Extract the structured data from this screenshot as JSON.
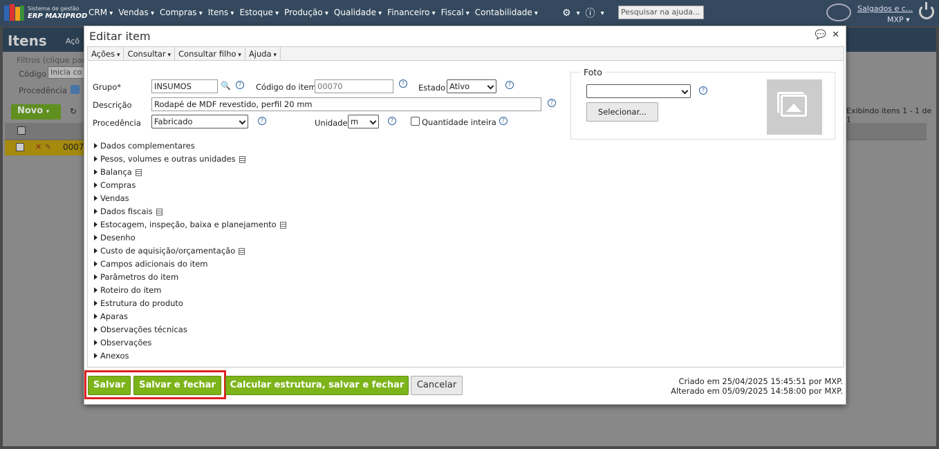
{
  "topbar": {
    "logo_line1": "Sistema de gestão",
    "logo_line2": "ERP MAXIPROD",
    "menu": [
      "CRM",
      "Vendas",
      "Compras",
      "Itens",
      "Estoque",
      "Produção",
      "Qualidade",
      "Financeiro",
      "Fiscal",
      "Contabilidade"
    ],
    "search_placeholder": "Pesquisar na ajuda...",
    "user_link": "Salgados e c...",
    "company": "MXP"
  },
  "page": {
    "title": "Itens",
    "acoes_partial": "Açõ",
    "filter_title": "Filtros (clique para",
    "filter_codigo_label": "Código",
    "filter_codigo_value": "Inicia co",
    "filter_procedencia_label": "Procedência",
    "novo_label": "Novo",
    "exibindo": "Exibindo itens 1 - 1 de 1",
    "row_code": "0007"
  },
  "dialog": {
    "title": "Editar item",
    "menu": [
      "Ações",
      "Consultar",
      "Consultar filho",
      "Ajuda"
    ],
    "grupo_label": "Grupo*",
    "grupo_value": "INSUMOS",
    "codigo_label": "Código do item",
    "codigo_placeholder": "00070",
    "estado_label": "Estado",
    "estado_value": "Ativo",
    "descricao_label": "Descrição",
    "descricao_value": "Rodapé de MDF revestido, perfil 20 mm",
    "procedencia_label": "Procedência",
    "procedencia_value": "Fabricado",
    "unidade_label": "Unidade",
    "unidade_value": "m",
    "quantidade_inteira_label": "Quantidade inteira",
    "foto_label": "Foto",
    "foto_select_value": "",
    "selecionar_label": "Selecionar...",
    "sections": [
      {
        "label": "Dados complementares",
        "doc": false
      },
      {
        "label": "Pesos, volumes e outras unidades",
        "doc": true
      },
      {
        "label": "Balança",
        "doc": true
      },
      {
        "label": "Compras",
        "doc": false
      },
      {
        "label": "Vendas",
        "doc": false
      },
      {
        "label": "Dados fiscais",
        "doc": true
      },
      {
        "label": "Estocagem, inspeção, baixa e planejamento",
        "doc": true
      },
      {
        "label": "Desenho",
        "doc": false
      },
      {
        "label": "Custo de aquisição/orçamentação",
        "doc": true
      },
      {
        "label": "Campos adicionais do item",
        "doc": false
      },
      {
        "label": "Parâmetros do item",
        "doc": false
      },
      {
        "label": "Roteiro do item",
        "doc": false
      },
      {
        "label": "Estrutura do produto",
        "doc": false
      },
      {
        "label": "Aparas",
        "doc": false
      },
      {
        "label": "Observações técnicas",
        "doc": false
      },
      {
        "label": "Observações",
        "doc": false
      },
      {
        "label": "Anexos",
        "doc": false
      }
    ],
    "buttons": {
      "salvar": "Salvar",
      "salvar_fechar": "Salvar e fechar",
      "calcular": "Calcular estrutura, salvar e fechar",
      "cancelar": "Cancelar"
    },
    "criado": "Criado em 25/04/2025 15:45:51 por MXP.",
    "alterado": "Alterado em 05/09/2025 14:58:00 por MXP."
  },
  "colors": {
    "topbar": "#34495e",
    "accent_green": "#7cb41a",
    "highlight": "#e02020"
  }
}
